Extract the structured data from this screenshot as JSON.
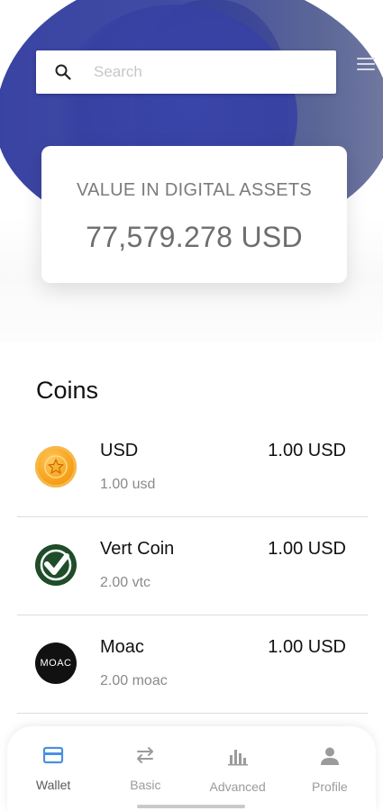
{
  "search": {
    "placeholder": "Search"
  },
  "portfolio": {
    "label": "VALUE IN DIGITAL ASSETS",
    "amount": "77,579.278 USD"
  },
  "coins": {
    "title": "Coins",
    "items": [
      {
        "name": "USD",
        "balance": "1.00 usd",
        "value": "1.00 USD",
        "icon": "usd-coin-icon"
      },
      {
        "name": "Vert Coin",
        "balance": "2.00 vtc",
        "value": "1.00 USD",
        "icon": "vertcoin-icon"
      },
      {
        "name": "Moac",
        "balance": "2.00 moac",
        "value": "1.00 USD",
        "icon": "moac-icon",
        "logo_text": "MOAC"
      }
    ]
  },
  "nav": {
    "items": [
      {
        "label": "Wallet",
        "icon": "wallet-icon",
        "active": true
      },
      {
        "label": "Basic",
        "icon": "swap-icon",
        "active": false
      },
      {
        "label": "Advanced",
        "icon": "chart-icon",
        "active": false
      },
      {
        "label": "Profile",
        "icon": "person-icon",
        "active": false
      }
    ]
  },
  "colors": {
    "header_blob": "#3f4ca3",
    "active_nav": "#4a90e2",
    "inactive_nav": "#9b9b9b"
  }
}
